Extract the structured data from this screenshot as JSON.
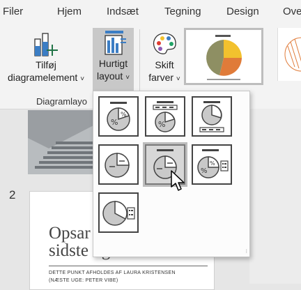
{
  "tabs": [
    "Filer",
    "Hjem",
    "Indsæt",
    "Tegning",
    "Design",
    "Ove"
  ],
  "ribbon": {
    "add_element": {
      "line1": "Tilføj",
      "line2": "diagramelement",
      "chevron": "˅"
    },
    "quick_layout": {
      "line1": "Hurtigt",
      "line2": "layout",
      "chevron": "˅"
    },
    "change_colors": {
      "line1": "Skift",
      "line2": "farver",
      "chevron": "˅"
    },
    "group_label": "Diagramlayo"
  },
  "quick_layout_menu": {
    "layouts": [
      {
        "name": "layout-1",
        "selected": false
      },
      {
        "name": "layout-2",
        "selected": false
      },
      {
        "name": "layout-3",
        "selected": false
      },
      {
        "name": "layout-4",
        "selected": false
      },
      {
        "name": "layout-5",
        "selected": true
      },
      {
        "name": "layout-6",
        "selected": false
      },
      {
        "name": "layout-7",
        "selected": false
      }
    ]
  },
  "slides": {
    "slide2_number": "2",
    "slide2_title_line1": "Opsar",
    "slide2_title_line2": "sidste uge",
    "slide2_text_line1": "DETTE PUNKT AFHOLDES AF LAURA KRISTENSEN",
    "slide2_text_line2": "(NÆSTE UGE: PETER VIBE)"
  },
  "colors": {
    "accent": "#217346",
    "pie_orange": "#e07b39",
    "pie_olive": "#8e8f63",
    "pie_yellow": "#f2c12e"
  }
}
